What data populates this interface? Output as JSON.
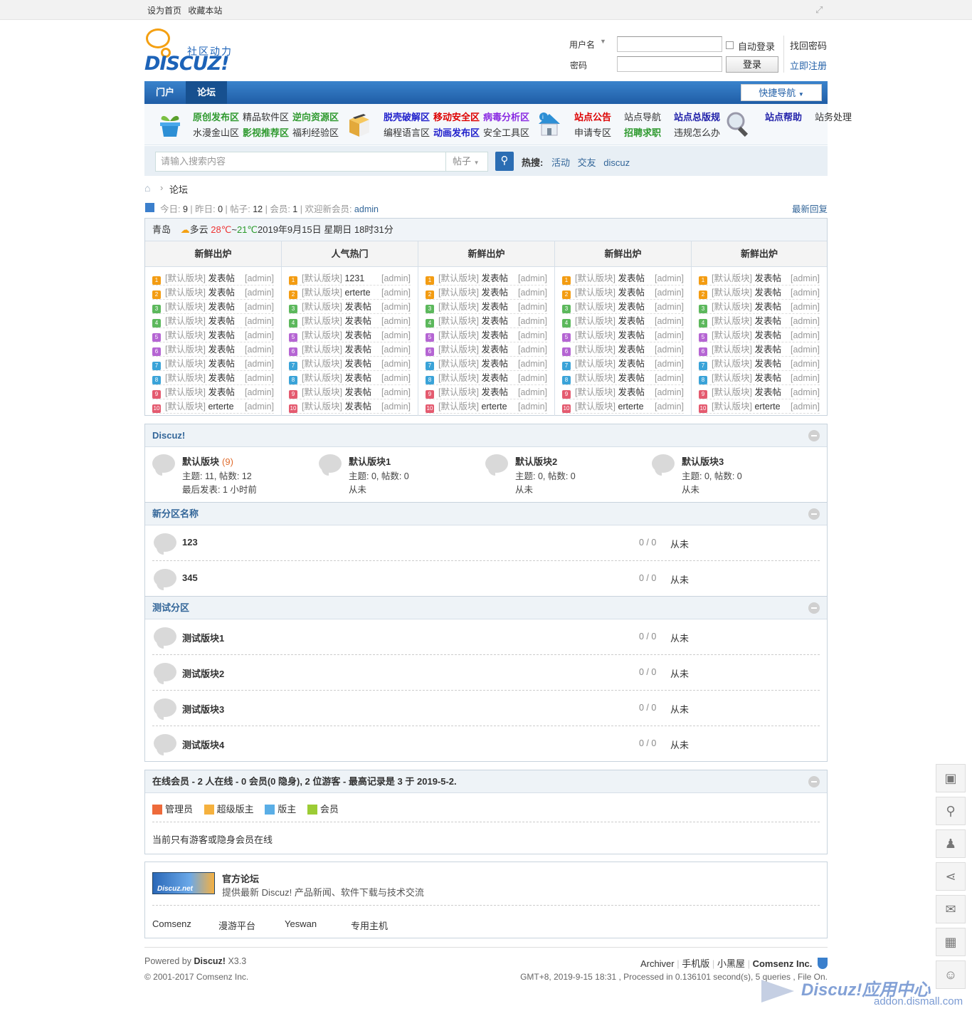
{
  "topbar": {
    "set_home": "设为首页",
    "bookmark": "收藏本站"
  },
  "logo": {
    "text": "DISCUZ!",
    "sub": "社区动力"
  },
  "login": {
    "username_label": "用户名",
    "password_label": "密码",
    "auto_login": "自动登录",
    "login_button": "登录",
    "find_password": "找回密码",
    "register": "立即注册"
  },
  "nav": {
    "portal": "门户",
    "forum": "论坛",
    "quick_nav": "快捷导航"
  },
  "quick_links": {
    "g1": [
      {
        "t": "原创发布区",
        "c": "#2f9a2f"
      },
      {
        "t": "精品软件区",
        "c": "#333"
      },
      {
        "t": "逆向资源区",
        "c": "#2f9a2f"
      },
      {
        "t": "水漫金山区",
        "c": "#333"
      },
      {
        "t": "影视推荐区",
        "c": "#2f9a2f"
      },
      {
        "t": "福利经验区",
        "c": "#333"
      }
    ],
    "g2": [
      {
        "t": "脱壳破解区",
        "c": "#2222cc"
      },
      {
        "t": "移动安全区",
        "c": "#dd0000"
      },
      {
        "t": "病毒分析区",
        "c": "#8a2be2"
      },
      {
        "t": "编程语言区",
        "c": "#333"
      },
      {
        "t": "动画发布区",
        "c": "#2222cc"
      },
      {
        "t": "安全工具区",
        "c": "#333"
      }
    ],
    "g3": [
      {
        "t": "站点公告",
        "c": "#dd0000"
      },
      {
        "t": "站点导航",
        "c": "#333"
      },
      {
        "t": "站点总版规",
        "c": "#2222aa"
      },
      {
        "t": "申请专区",
        "c": "#333"
      },
      {
        "t": "招聘求职",
        "c": "#2f9a2f"
      },
      {
        "t": "违规怎么办",
        "c": "#333"
      }
    ],
    "g4": [
      {
        "t": "站点帮助",
        "c": "#2222aa"
      },
      {
        "t": "站务处理",
        "c": "#333"
      }
    ]
  },
  "search": {
    "placeholder": "请输入搜索内容",
    "type": "帖子",
    "hot_label": "热搜:",
    "hot": [
      "活动",
      "交友",
      "discuz"
    ]
  },
  "breadcrumb": {
    "current": "论坛"
  },
  "stats": {
    "today_label": "今日:",
    "today": "9",
    "yesterday_label": "昨日:",
    "yesterday": "0",
    "posts_label": "帖子:",
    "posts": "12",
    "members_label": "会员:",
    "members": "1",
    "welcome_label": "欢迎新会员:",
    "newest": "admin",
    "latest_reply": "最新回复"
  },
  "weather": {
    "city": "青岛",
    "cond": "多云",
    "high": "28℃",
    "sep": "~",
    "low": "21℃",
    "datetime": "2019年9月15日 星期日 18时31分"
  },
  "hot_columns": [
    {
      "title": "新鲜出炉",
      "items": [
        {
          "n": "1",
          "t": "发表帖"
        },
        {
          "n": "2",
          "t": "发表帖"
        },
        {
          "n": "3",
          "t": "发表帖"
        },
        {
          "n": "4",
          "t": "发表帖"
        },
        {
          "n": "5",
          "t": "发表帖"
        },
        {
          "n": "6",
          "t": "发表帖"
        },
        {
          "n": "7",
          "t": "发表帖"
        },
        {
          "n": "8",
          "t": "发表帖"
        },
        {
          "n": "9",
          "t": "发表帖"
        },
        {
          "n": "10",
          "t": "erterte"
        }
      ]
    },
    {
      "title": "人气热门",
      "items": [
        {
          "n": "1",
          "t": "1231"
        },
        {
          "n": "2",
          "t": "erterte"
        },
        {
          "n": "3",
          "t": "发表帖"
        },
        {
          "n": "4",
          "t": "发表帖"
        },
        {
          "n": "5",
          "t": "发表帖"
        },
        {
          "n": "6",
          "t": "发表帖"
        },
        {
          "n": "7",
          "t": "发表帖"
        },
        {
          "n": "8",
          "t": "发表帖"
        },
        {
          "n": "9",
          "t": "发表帖"
        },
        {
          "n": "10",
          "t": "发表帖"
        }
      ]
    },
    {
      "title": "新鲜出炉",
      "items": [
        {
          "n": "1",
          "t": "发表帖"
        },
        {
          "n": "2",
          "t": "发表帖"
        },
        {
          "n": "3",
          "t": "发表帖"
        },
        {
          "n": "4",
          "t": "发表帖"
        },
        {
          "n": "5",
          "t": "发表帖"
        },
        {
          "n": "6",
          "t": "发表帖"
        },
        {
          "n": "7",
          "t": "发表帖"
        },
        {
          "n": "8",
          "t": "发表帖"
        },
        {
          "n": "9",
          "t": "发表帖"
        },
        {
          "n": "10",
          "t": "erterte"
        }
      ]
    },
    {
      "title": "新鲜出炉",
      "items": [
        {
          "n": "1",
          "t": "发表帖"
        },
        {
          "n": "2",
          "t": "发表帖"
        },
        {
          "n": "3",
          "t": "发表帖"
        },
        {
          "n": "4",
          "t": "发表帖"
        },
        {
          "n": "5",
          "t": "发表帖"
        },
        {
          "n": "6",
          "t": "发表帖"
        },
        {
          "n": "7",
          "t": "发表帖"
        },
        {
          "n": "8",
          "t": "发表帖"
        },
        {
          "n": "9",
          "t": "发表帖"
        },
        {
          "n": "10",
          "t": "erterte"
        }
      ]
    },
    {
      "title": "新鲜出炉",
      "items": [
        {
          "n": "1",
          "t": "发表帖"
        },
        {
          "n": "2",
          "t": "发表帖"
        },
        {
          "n": "3",
          "t": "发表帖"
        },
        {
          "n": "4",
          "t": "发表帖"
        },
        {
          "n": "5",
          "t": "发表帖"
        },
        {
          "n": "6",
          "t": "发表帖"
        },
        {
          "n": "7",
          "t": "发表帖"
        },
        {
          "n": "8",
          "t": "发表帖"
        },
        {
          "n": "9",
          "t": "发表帖"
        },
        {
          "n": "10",
          "t": "erterte"
        }
      ]
    }
  ],
  "hot_item_forum": "[默认版块]",
  "hot_item_author": "[admin]",
  "rank_colors": [
    "#f39c12",
    "#f39c12",
    "#5cb85c",
    "#5cb85c",
    "#b565d3",
    "#b565d3",
    "#3aa3d8",
    "#3aa3d8",
    "#e45a6f",
    "#e45a6f"
  ],
  "cat_discuz": {
    "title": "Discuz!",
    "forums": [
      {
        "name": "默认版块",
        "today": "(9)",
        "stat": "主题: 11, 帖数: 12",
        "last": "最后发表: 1 小时前"
      },
      {
        "name": "默认版块1",
        "today": "",
        "stat": "主题: 0, 帖数: 0",
        "last": "从未"
      },
      {
        "name": "默认版块2",
        "today": "",
        "stat": "主题: 0, 帖数: 0",
        "last": "从未"
      },
      {
        "name": "默认版块3",
        "today": "",
        "stat": "主题: 0, 帖数: 0",
        "last": "从未"
      }
    ]
  },
  "cat_new": {
    "title": "新分区名称",
    "forums": [
      {
        "name": "123",
        "count": "0 / 0",
        "last": "从未"
      },
      {
        "name": "345",
        "count": "0 / 0",
        "last": "从未"
      }
    ]
  },
  "cat_test": {
    "title": "测试分区",
    "forums": [
      {
        "name": "测试版块1",
        "count": "0 / 0",
        "last": "从未"
      },
      {
        "name": "测试版块2",
        "count": "0 / 0",
        "last": "从未"
      },
      {
        "name": "测试版块3",
        "count": "0 / 0",
        "last": "从未"
      },
      {
        "name": "测试版块4",
        "count": "0 / 0",
        "last": "从未"
      }
    ]
  },
  "online": {
    "title": "在线会员",
    "summary": "- 2 人在线 - 0 会员(0 隐身), 2 位游客 - 最高记录是 3 于 2019-5-2.",
    "legend": [
      "管理员",
      "超级版主",
      "版主",
      "会员"
    ],
    "note": "当前只有游客或隐身会员在线"
  },
  "links": {
    "badge": "Discuz.net",
    "name": "官方论坛",
    "desc": "提供最新 Discuz! 产品新闻、软件下载与技术交流",
    "items": [
      "Comsenz",
      "漫游平台",
      "Yeswan",
      "专用主机"
    ]
  },
  "footer": {
    "powered": "Powered by",
    "brand": "Discuz!",
    "ver": "X3.3",
    "copyright": "© 2001-2017 Comsenz Inc.",
    "links": [
      "Archiver",
      "手机版",
      "小黑屋",
      "Comsenz Inc."
    ],
    "gmt": "GMT+8, 2019-9-15 18:31 , Processed in 0.136101 second(s), 5 queries , File On."
  },
  "watermark": {
    "brand": "Discuz!应用中心",
    "url": "addon.dismall.com"
  }
}
